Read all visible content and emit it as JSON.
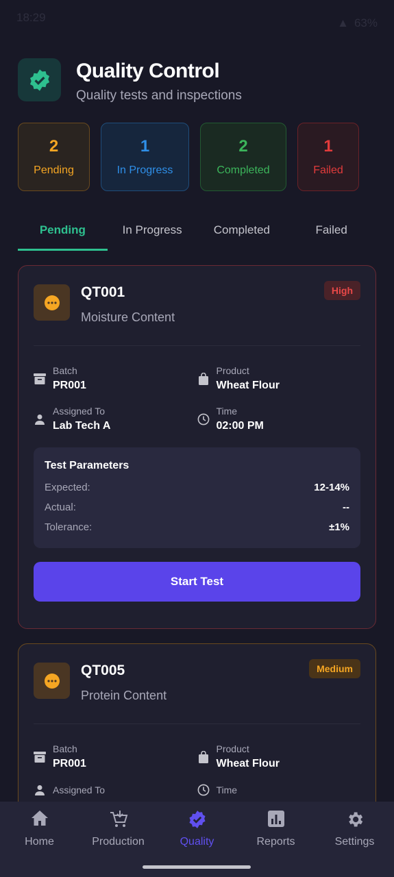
{
  "status_bar": {
    "time": "18:29",
    "battery": "63%"
  },
  "header": {
    "title": "Quality Control",
    "subtitle": "Quality tests and inspections",
    "icon": "verified-badge-icon"
  },
  "stats": [
    {
      "count": "2",
      "label": "Pending",
      "color": "#f5a623"
    },
    {
      "count": "1",
      "label": "In Progress",
      "color": "#2f8fe8"
    },
    {
      "count": "2",
      "label": "Completed",
      "color": "#3cb55b"
    },
    {
      "count": "1",
      "label": "Failed",
      "color": "#e23b3b"
    }
  ],
  "tabs": [
    "Pending",
    "In Progress",
    "Completed",
    "Failed"
  ],
  "active_tab": "Pending",
  "tests": [
    {
      "id": "QT001",
      "name": "Moisture Content",
      "priority": "High",
      "batch_label": "Batch",
      "batch": "PR001",
      "product_label": "Product",
      "product": "Wheat Flour",
      "assigned_label": "Assigned To",
      "assigned": "Lab Tech A",
      "time_label": "Time",
      "time": "02:00 PM",
      "params_title": "Test Parameters",
      "expected_label": "Expected:",
      "expected": "12-14%",
      "actual_label": "Actual:",
      "actual": "--",
      "tolerance_label": "Tolerance:",
      "tolerance": "±1%",
      "action": "Start Test"
    },
    {
      "id": "QT005",
      "name": "Protein Content",
      "priority": "Medium",
      "batch_label": "Batch",
      "batch": "PR001",
      "product_label": "Product",
      "product": "Wheat Flour",
      "assigned_label": "Assigned To",
      "time_label": "Time"
    }
  ],
  "nav": [
    {
      "label": "Home",
      "icon": "home-icon"
    },
    {
      "label": "Production",
      "icon": "cart-icon"
    },
    {
      "label": "Quality",
      "icon": "verified-badge-icon"
    },
    {
      "label": "Reports",
      "icon": "bar-chart-icon"
    },
    {
      "label": "Settings",
      "icon": "gear-icon"
    }
  ],
  "active_nav": "Quality"
}
